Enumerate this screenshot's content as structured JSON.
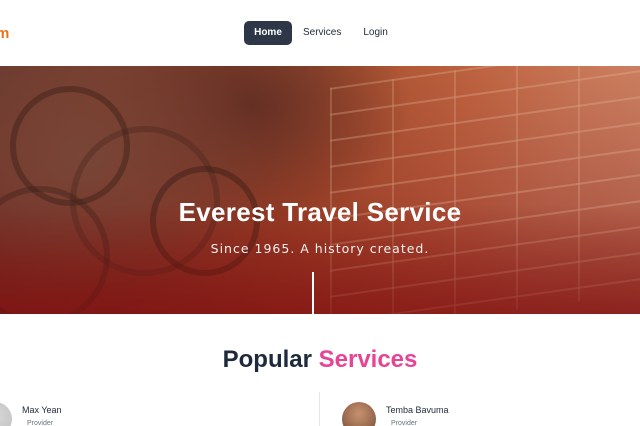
{
  "brand": {
    "text": "m"
  },
  "nav": {
    "items": [
      {
        "label": "Home",
        "active": true
      },
      {
        "label": "Services",
        "active": false
      },
      {
        "label": "Login",
        "active": false
      }
    ]
  },
  "hero": {
    "title": "Everest Travel Service",
    "subtitle": "Since 1965. A history created."
  },
  "section": {
    "title_main": "Popular",
    "title_accent": "Services"
  },
  "providers": [
    {
      "name": "Max Yean",
      "role": "Provider"
    },
    {
      "name": "Temba Bavuma",
      "role": "Provider"
    }
  ],
  "colors": {
    "brand": "#e8741a",
    "nav_active_bg": "#2d3748",
    "accent": "#e64596",
    "heading": "#1e2a3b"
  }
}
